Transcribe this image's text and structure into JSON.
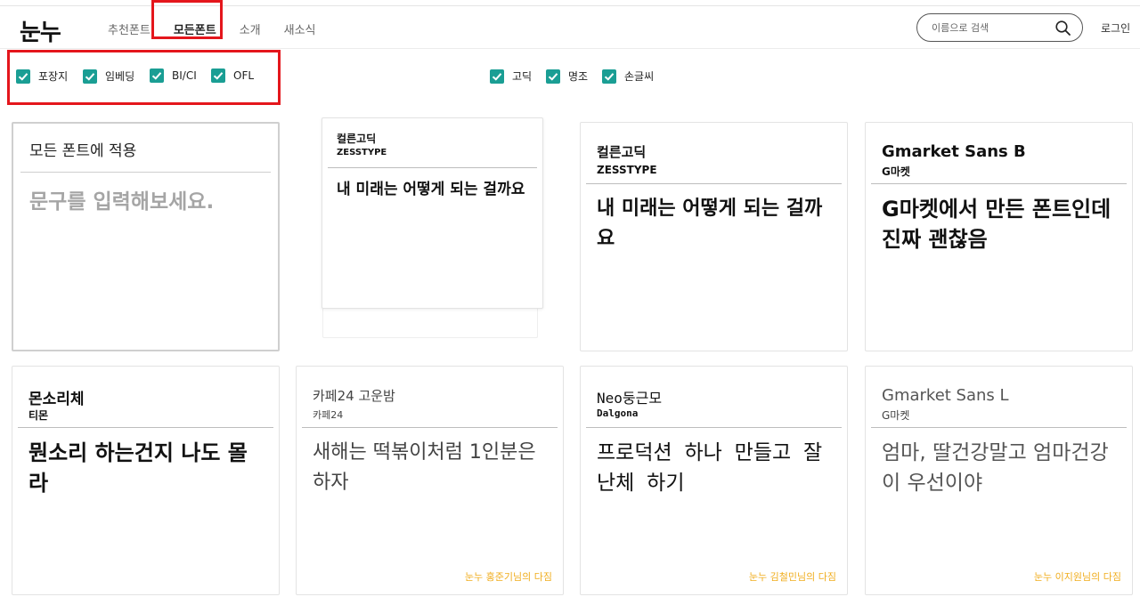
{
  "header": {
    "logo": "눈누",
    "nav": [
      "추천폰트",
      "모든폰트",
      "소개",
      "새소식"
    ],
    "active_nav": "모든폰트",
    "search_placeholder": "이름으로 검색",
    "search_icon": "search-icon",
    "login": "로그인"
  },
  "filters": {
    "license": [
      "포장지",
      "임베딩",
      "BI/CI",
      "OFL"
    ],
    "style": [
      "고딕",
      "명조",
      "손글씨"
    ],
    "all_checked": true,
    "check_color": "#1a9e94"
  },
  "apply_card": {
    "title": "모든 폰트에 적용",
    "placeholder": "문구를 입력해보세요."
  },
  "cards": [
    {
      "name": "컬른고딕",
      "maker": "ZESSTYPE",
      "sample": "내 미래는 어떻게 되는 걸까요",
      "credit": ""
    },
    {
      "name": "컬른고딕",
      "maker": "ZESSTYPE",
      "sample": "내 미래는 어떻게 되는 걸까요",
      "credit": ""
    },
    {
      "name": "Gmarket Sans B",
      "maker": "G마켓",
      "sample": "G마켓에서 만든 폰트인데 진짜 괜찮음",
      "credit": ""
    },
    {
      "name": "몬소리체",
      "maker": "티몬",
      "sample": "뭔소리 하는건지 나도 몰라",
      "credit": ""
    },
    {
      "name": "카페24 고운밤",
      "maker": "카페24",
      "sample": "새해는 떡볶이처럼 1인분은 하자",
      "credit": "눈누 홍준기님의 다짐"
    },
    {
      "name": "Neo둥근모",
      "maker": "Dalgona",
      "sample": "프로덕션 하나 만들고 잘난체 하기",
      "credit": "눈누 김철민님의 다짐"
    },
    {
      "name": "Gmarket Sans L",
      "maker": "G마켓",
      "sample": "엄마, 딸건강말고 엄마건강이 우선이야",
      "credit": "눈누 이지원님의 다짐"
    }
  ],
  "colors": {
    "accent": "#1a9e94",
    "highlight": "#e4161c",
    "credit": "#f0ad1e"
  }
}
